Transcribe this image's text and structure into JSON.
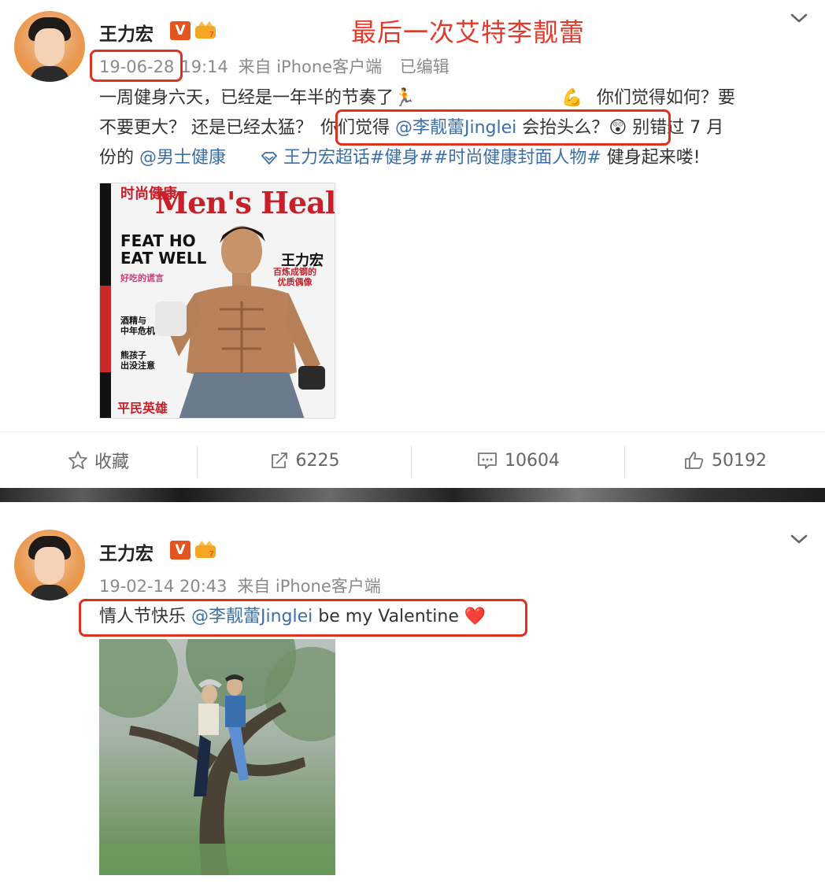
{
  "overlay_title": "最后一次艾特李靓蕾",
  "post1": {
    "user": "王力宏",
    "verified_badge": "V",
    "date": "19-06-28",
    "time": "19:14",
    "source": "来自 iPhone客户端",
    "edited": "已编辑",
    "text_line1_a": "一周健身六天，已经是一年半的节奏了",
    "text_line1_b": "你们觉得如何？要",
    "text_line2_a": "不要更大？ 还是已经太猛？",
    "text_line2_b": "你们觉得",
    "mention_jinglei": "@李靓蕾Jinglei",
    "text_line2_c": "会抬头么？",
    "text_line2_d": "别错过 7 月",
    "text_line3_a": "份的",
    "mention_menshealth": "@男士健康",
    "topic": "王力宏超话#健身##时尚健康封面人物#",
    "text_line3_b": "健身起来喽!",
    "magazine": {
      "title_cn": "时尚健康",
      "title_en": "Men's Health",
      "headline": "FEAT HO\nEAT WELL",
      "sub_pink": "好吃的谎言",
      "cover_name": "王力宏",
      "cover_tag": "百炼成钢的\n优质偶像",
      "side1": "酒精与\n中年危机",
      "side2": "熊孩子\n出没注意",
      "bottom": "平民英雄"
    },
    "actions": {
      "favorite": "收藏",
      "repost": "6225",
      "comment": "10604",
      "like": "50192"
    }
  },
  "post2": {
    "user": "王力宏",
    "verified_badge": "V",
    "datetime": "19-02-14 20:43",
    "source": "来自 iPhone客户端",
    "text_a": "情人节快乐",
    "mention_jinglei": "@李靓蕾Jinglei",
    "text_b": "be my Valentine"
  },
  "colors": {
    "link": "#3b6fa6",
    "annotation_red": "#e0301e",
    "verified_orange": "#e2551f"
  }
}
